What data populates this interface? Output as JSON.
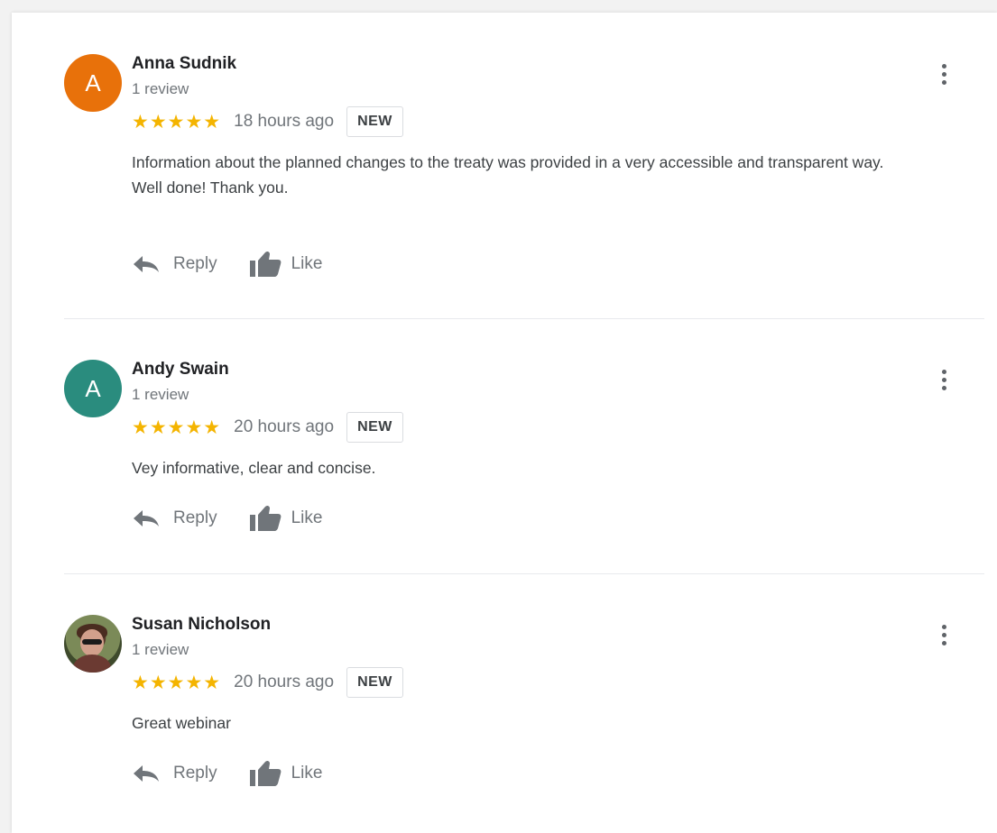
{
  "colors": {
    "star": "#f4b400",
    "avatar_orange": "#e8710a",
    "avatar_teal": "#2a8c7e",
    "muted_text": "#70757a"
  },
  "icons": {
    "reply": "reply-arrow-icon",
    "like": "thumbs-up-icon",
    "more": "more-vertical-icon",
    "star": "star-icon"
  },
  "actions": {
    "reply_label": "Reply",
    "like_label": "Like"
  },
  "reviews": [
    {
      "avatar_letter": "A",
      "avatar_color": "#e8710a",
      "name": "Anna Sudnik",
      "review_count": "1 review",
      "rating": 5,
      "stars": "★★★★★",
      "time": "18 hours ago",
      "badge": "NEW",
      "text_lines": [
        "Information about the planned changes to the treaty was provided in a very accessible and transparent way.",
        "Well done! Thank you."
      ]
    },
    {
      "avatar_letter": "A",
      "avatar_color": "#2a8c7e",
      "name": "Andy Swain",
      "review_count": "1 review",
      "rating": 5,
      "stars": "★★★★★",
      "time": "20 hours ago",
      "badge": "NEW",
      "text_lines": [
        "Vey informative, clear and concise."
      ]
    },
    {
      "avatar_letter": "",
      "avatar_color": "",
      "name": "Susan Nicholson",
      "review_count": "1 review",
      "rating": 5,
      "stars": "★★★★★",
      "time": "20 hours ago",
      "badge": "NEW",
      "text_lines": [
        "Great webinar"
      ]
    }
  ]
}
